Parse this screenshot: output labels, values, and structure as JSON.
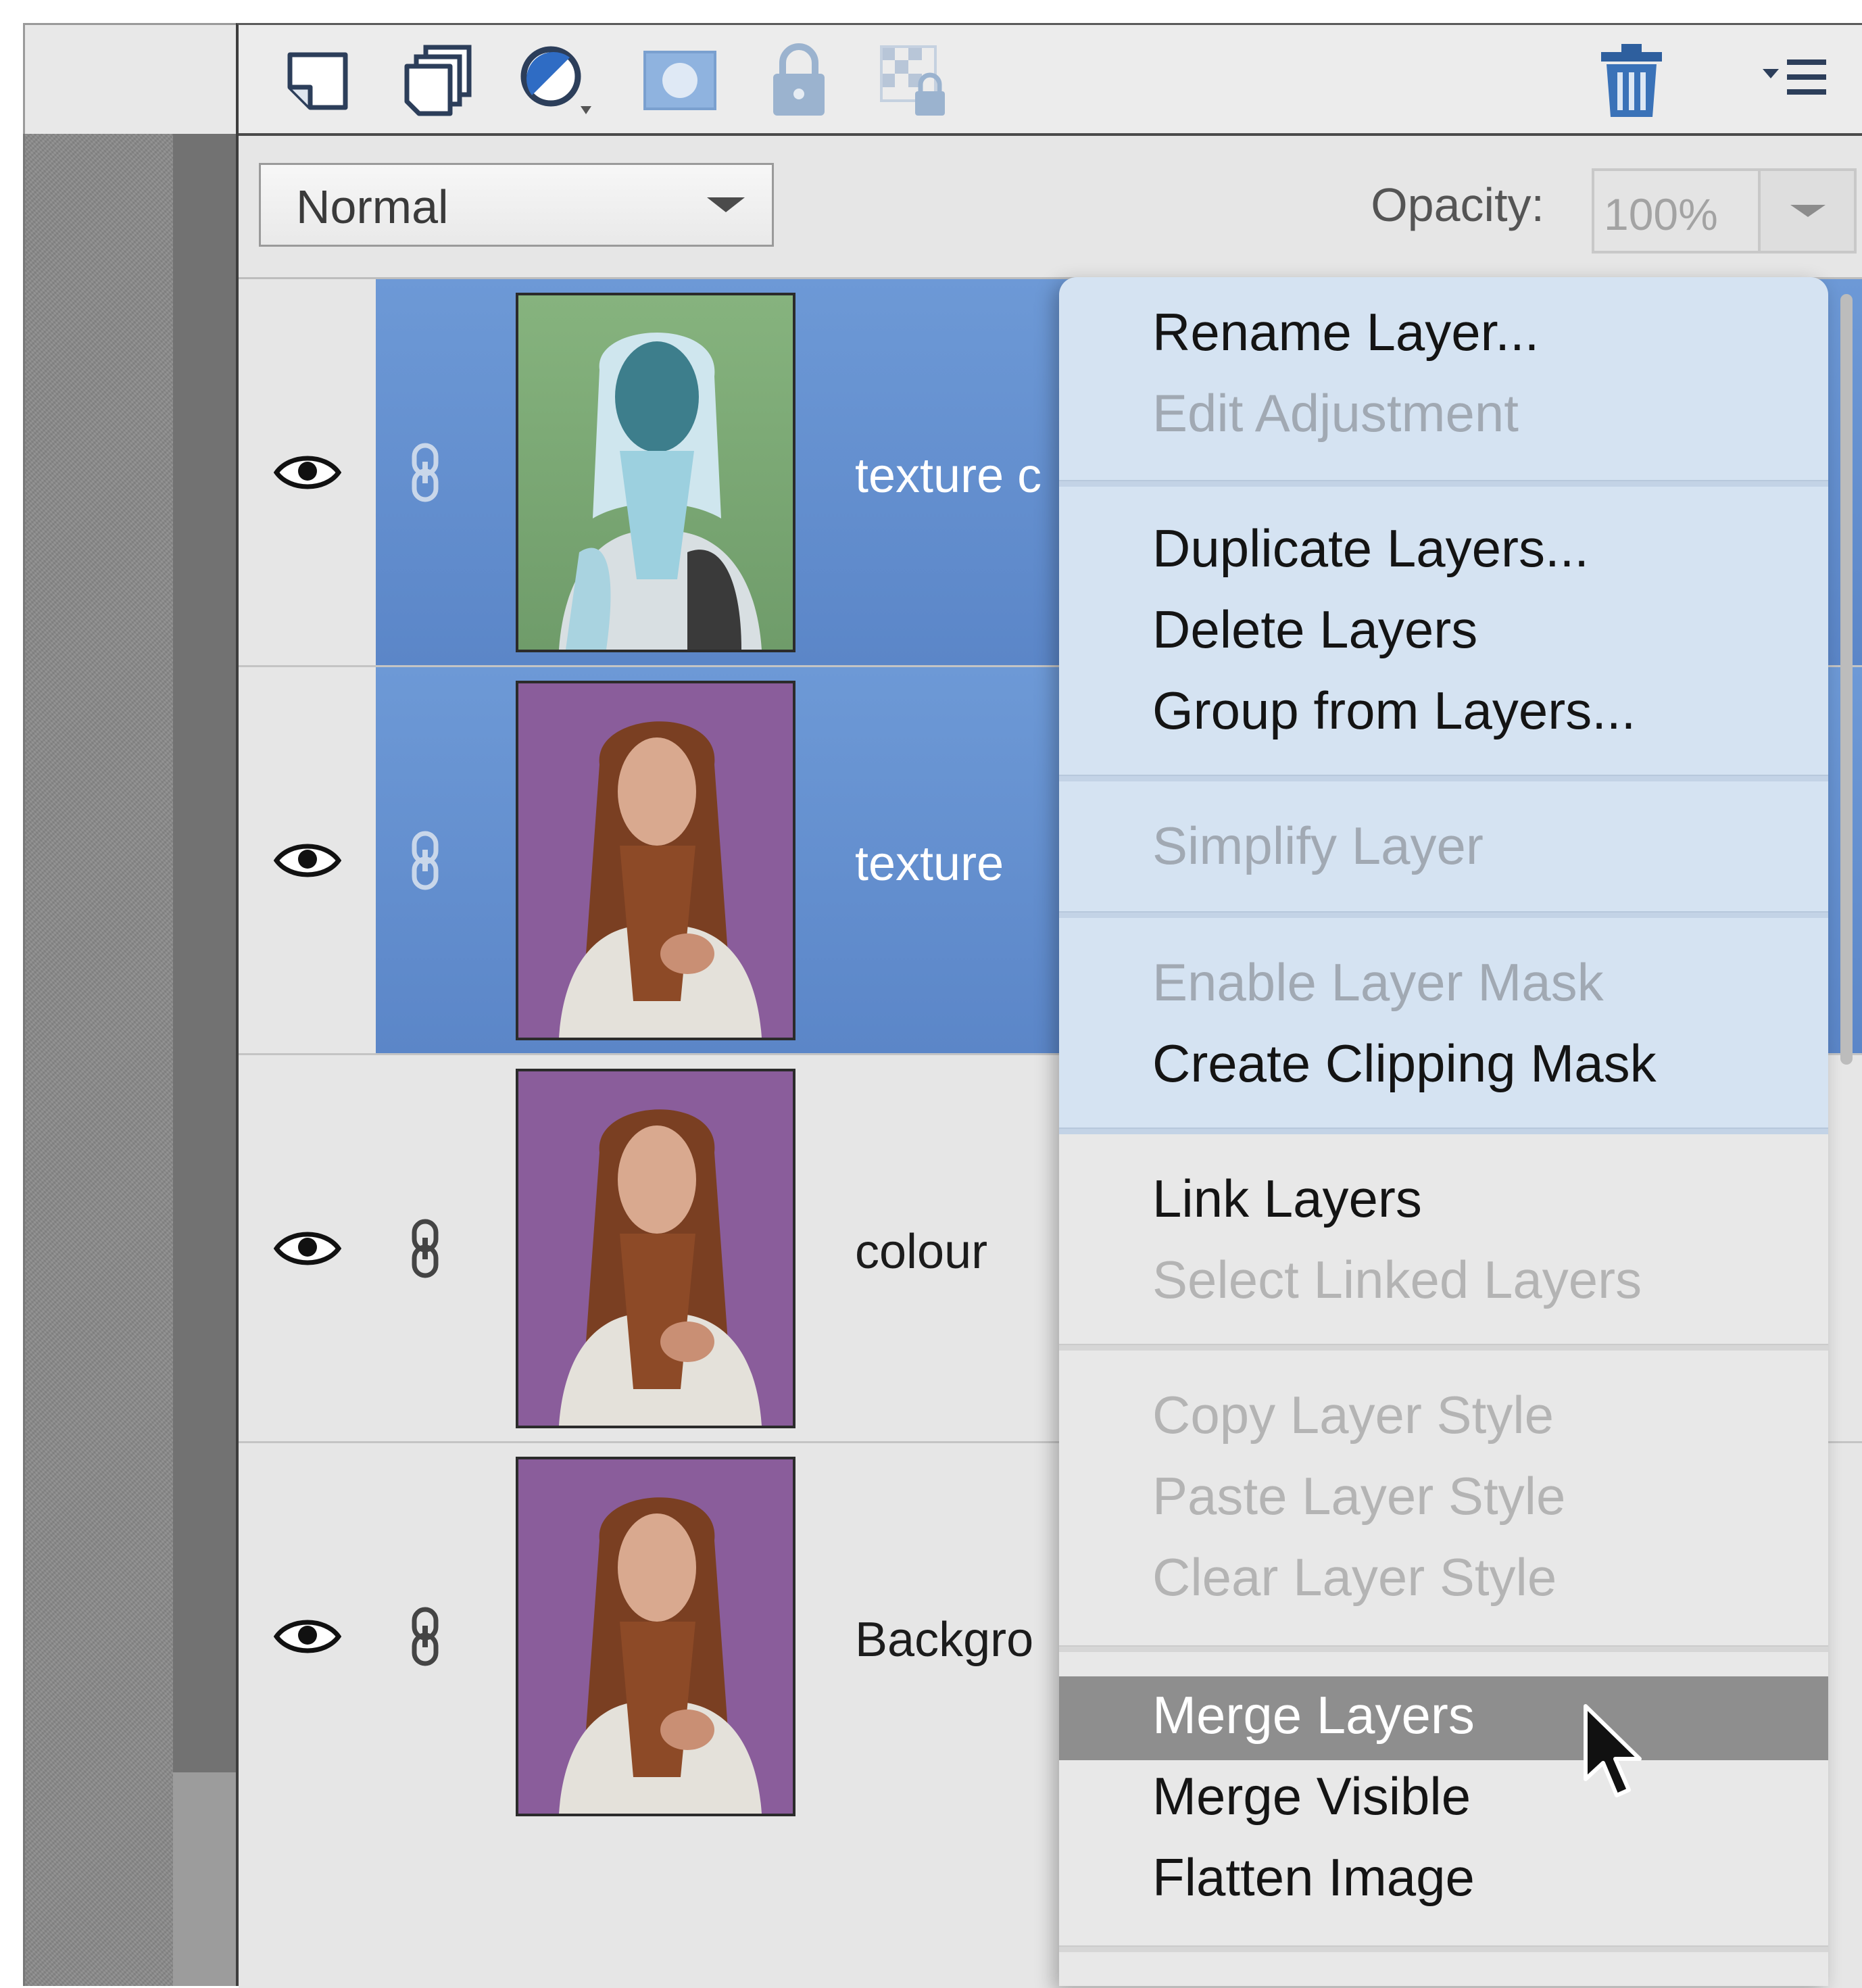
{
  "colors": {
    "selection": "#6189cc",
    "menu_background": "#d5e3f2",
    "menu_highlight": "#8e8e8e",
    "disabled_text": "#a1a9b3"
  },
  "toolbar": {
    "icons": [
      "new-layer-icon",
      "new-group-icon",
      "adjustment-layer-icon",
      "add-mask-icon",
      "lock-all-icon",
      "lock-transparency-icon",
      "trash-icon",
      "panel-menu-icon"
    ]
  },
  "blend_mode": {
    "value": "Normal"
  },
  "opacity": {
    "label": "Opacity:",
    "value": "100%"
  },
  "layers": [
    {
      "name": "texture c",
      "selected": true,
      "thumbnail": "inverted-portrait"
    },
    {
      "name": "texture",
      "selected": true,
      "thumbnail": "portrait"
    },
    {
      "name": "colour",
      "selected": false,
      "thumbnail": "portrait"
    },
    {
      "name": "Backgro",
      "selected": false,
      "thumbnail": "portrait"
    }
  ],
  "context_menu": {
    "items": [
      {
        "label": "Rename Layer...",
        "enabled": true
      },
      {
        "label": "Edit Adjustment",
        "enabled": false
      },
      {
        "label": "Duplicate Layers...",
        "enabled": true
      },
      {
        "label": "Delete Layers",
        "enabled": true
      },
      {
        "label": "Group from Layers...",
        "enabled": true
      },
      {
        "label": "Simplify Layer",
        "enabled": false
      },
      {
        "label": "Enable Layer Mask",
        "enabled": false
      },
      {
        "label": "Create Clipping Mask",
        "enabled": true
      },
      {
        "label": "Link Layers",
        "enabled": true
      },
      {
        "label": "Select Linked Layers",
        "enabled": false
      },
      {
        "label": "Copy Layer Style",
        "enabled": false
      },
      {
        "label": "Paste Layer Style",
        "enabled": false
      },
      {
        "label": "Clear Layer Style",
        "enabled": false
      },
      {
        "label": "Merge Layers",
        "enabled": true,
        "highlighted": true
      },
      {
        "label": "Merge Visible",
        "enabled": true
      },
      {
        "label": "Flatten Image",
        "enabled": true
      }
    ]
  }
}
